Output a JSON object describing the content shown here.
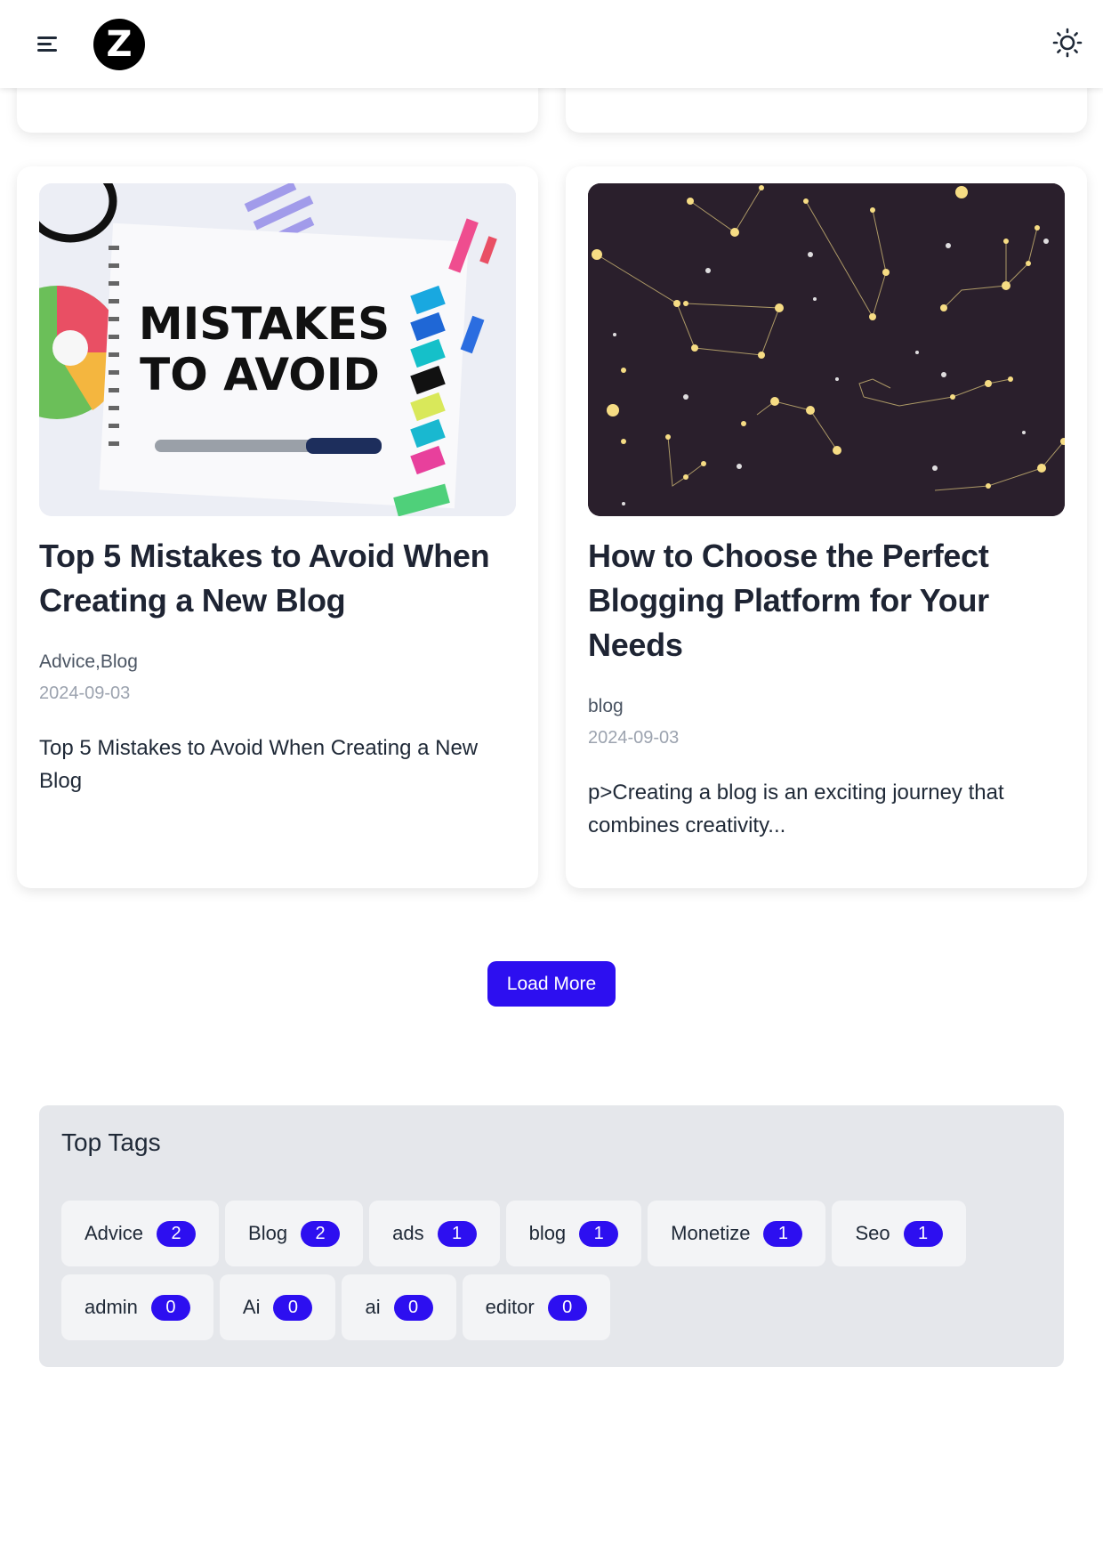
{
  "header": {
    "logo_letter": "Z",
    "icons": {
      "menu": "hamburger-menu-icon",
      "theme": "sun-icon"
    }
  },
  "posts": [
    {
      "title": "Top 5 Mistakes to Avoid When Creating a New Blog",
      "categories": "Advice,Blog",
      "date": "2024-09-03",
      "excerpt": "Top 5 Mistakes to Avoid When Creating a New Blog",
      "image_text_line1": "MISTAKES",
      "image_text_line2": "TO AVOID"
    },
    {
      "title": "How to Choose the Perfect Blogging Platform for Your Needs",
      "categories": "blog",
      "date": "2024-09-03",
      "excerpt": "p>Creating a blog is an exciting journey that combines creativity..."
    }
  ],
  "load_more_label": "Load More",
  "top_tags": {
    "title": "Top Tags",
    "tags": [
      {
        "name": "Advice",
        "count": "2"
      },
      {
        "name": "Blog",
        "count": "2"
      },
      {
        "name": "ads",
        "count": "1"
      },
      {
        "name": "blog",
        "count": "1"
      },
      {
        "name": "Monetize",
        "count": "1"
      },
      {
        "name": "Seo",
        "count": "1"
      },
      {
        "name": "admin",
        "count": "0"
      },
      {
        "name": "Ai",
        "count": "0"
      },
      {
        "name": "ai",
        "count": "0"
      },
      {
        "name": "editor",
        "count": "0"
      }
    ]
  },
  "colors": {
    "accent": "#2d0ff0",
    "tags_panel_bg": "#e5e7eb",
    "tag_bg": "#f3f4f6",
    "night_sky": "#2a1f2c"
  }
}
